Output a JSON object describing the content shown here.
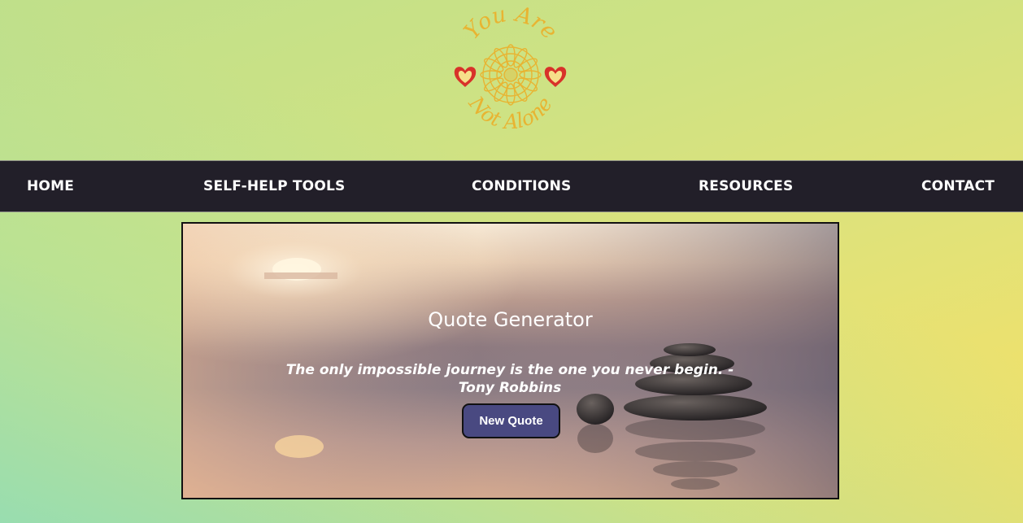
{
  "logo": {
    "text_top": "You Are",
    "text_bottom": "Not Alone"
  },
  "nav": {
    "items": [
      {
        "label": "HOME"
      },
      {
        "label": "SELF-HELP TOOLS"
      },
      {
        "label": "CONDITIONS"
      },
      {
        "label": "RESOURCES"
      },
      {
        "label": "CONTACT"
      }
    ]
  },
  "quote_generator": {
    "title": "Quote Generator",
    "quote": "The only impossible journey is the one you never begin. -Tony Robbins",
    "button_label": "New Quote"
  },
  "colors": {
    "nav_background": "#221f29",
    "button_background": "#494981",
    "logo_gold": "#e8b432",
    "heart_red": "#d8322a"
  },
  "icons": {
    "logo": "mandala-with-hearts-logo",
    "background": "zen-stones-sunset-image"
  }
}
